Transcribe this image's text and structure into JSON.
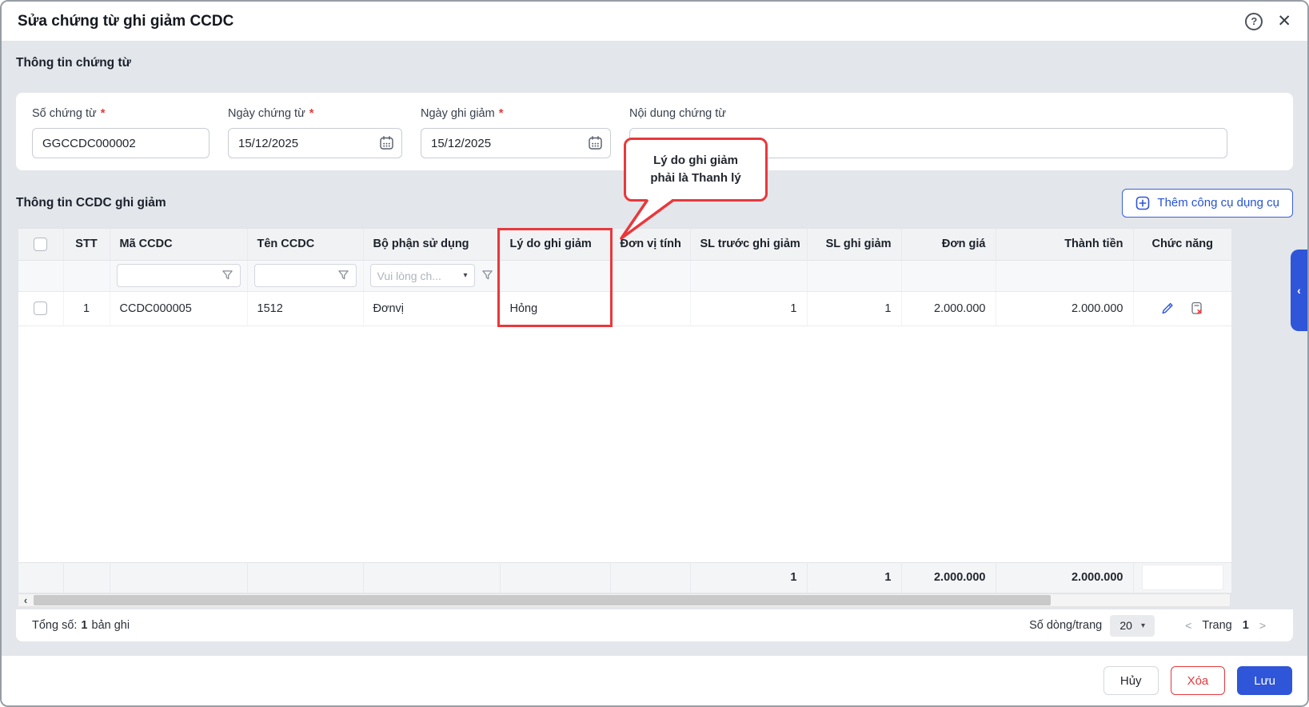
{
  "header": {
    "title": "Sửa chứng từ ghi giảm CCDC",
    "help_icon": "?",
    "close_icon": "✕"
  },
  "doc_section": {
    "title": "Thông tin chứng từ",
    "required_mark": "*",
    "fields": {
      "so_chung_tu": {
        "label": "Số chứng từ",
        "value": "GGCCDC000002"
      },
      "ngay_chung_tu": {
        "label": "Ngày chứng từ",
        "value": "15/12/2025"
      },
      "ngay_ghi_giam": {
        "label": "Ngày ghi giảm",
        "value": "15/12/2025"
      },
      "noi_dung": {
        "label": "Nội dung chứng từ",
        "value": ""
      }
    }
  },
  "callout": {
    "line1": "Lý do ghi giảm",
    "line2": "phải là Thanh lý"
  },
  "table_section": {
    "title": "Thông tin CCDC ghi giảm",
    "add_button_label": "Thêm công cụ dụng cụ",
    "columns": [
      "",
      "STT",
      "Mã CCDC",
      "Tên CCDC",
      "Bộ phận sử dụng",
      "Lý do ghi giảm",
      "Đơn vị tính",
      "SL trước ghi giảm",
      "SL ghi giảm",
      "Đơn giá",
      "Thành tiền",
      "Chức năng"
    ],
    "filters": {
      "ma_ccdc_value": "",
      "ten_ccdc_value": "",
      "bo_phan_placeholder": "Vui lòng ch...",
      "dropdown_caret": "▾"
    },
    "rows": [
      {
        "stt": "1",
        "ma_ccdc": "CCDC000005",
        "ten_ccdc": "1512",
        "bo_phan": "Đơnvị",
        "ly_do": "Hỏng",
        "don_vi_tinh": "",
        "sl_truoc": "1",
        "sl_ghi_giam": "1",
        "don_gia": "2.000.000",
        "thanh_tien": "2.000.000"
      }
    ],
    "summary": {
      "sl_truoc": "1",
      "sl_ghi_giam": "1",
      "don_gia": "2.000.000",
      "thanh_tien": "2.000.000"
    }
  },
  "scrollbar": {
    "left_arrow": "‹"
  },
  "footer": {
    "total_prefix": "Tổng số:",
    "total_count": "1",
    "total_suffix": "bản ghi",
    "rows_per_page_label": "Số dòng/trang",
    "rows_per_page_value": "20",
    "select_caret": "▾",
    "prev_icon": "<",
    "page_label": "Trang",
    "page_value": "1",
    "next_icon": ">"
  },
  "side_tab": {
    "collapse_icon": "‹"
  },
  "actions": {
    "cancel": "Hủy",
    "delete": "Xóa",
    "save": "Lưu"
  },
  "colors": {
    "accent_blue": "#2f55d8",
    "alert_red": "#e8383c",
    "body_gray": "#e3e6ea"
  }
}
